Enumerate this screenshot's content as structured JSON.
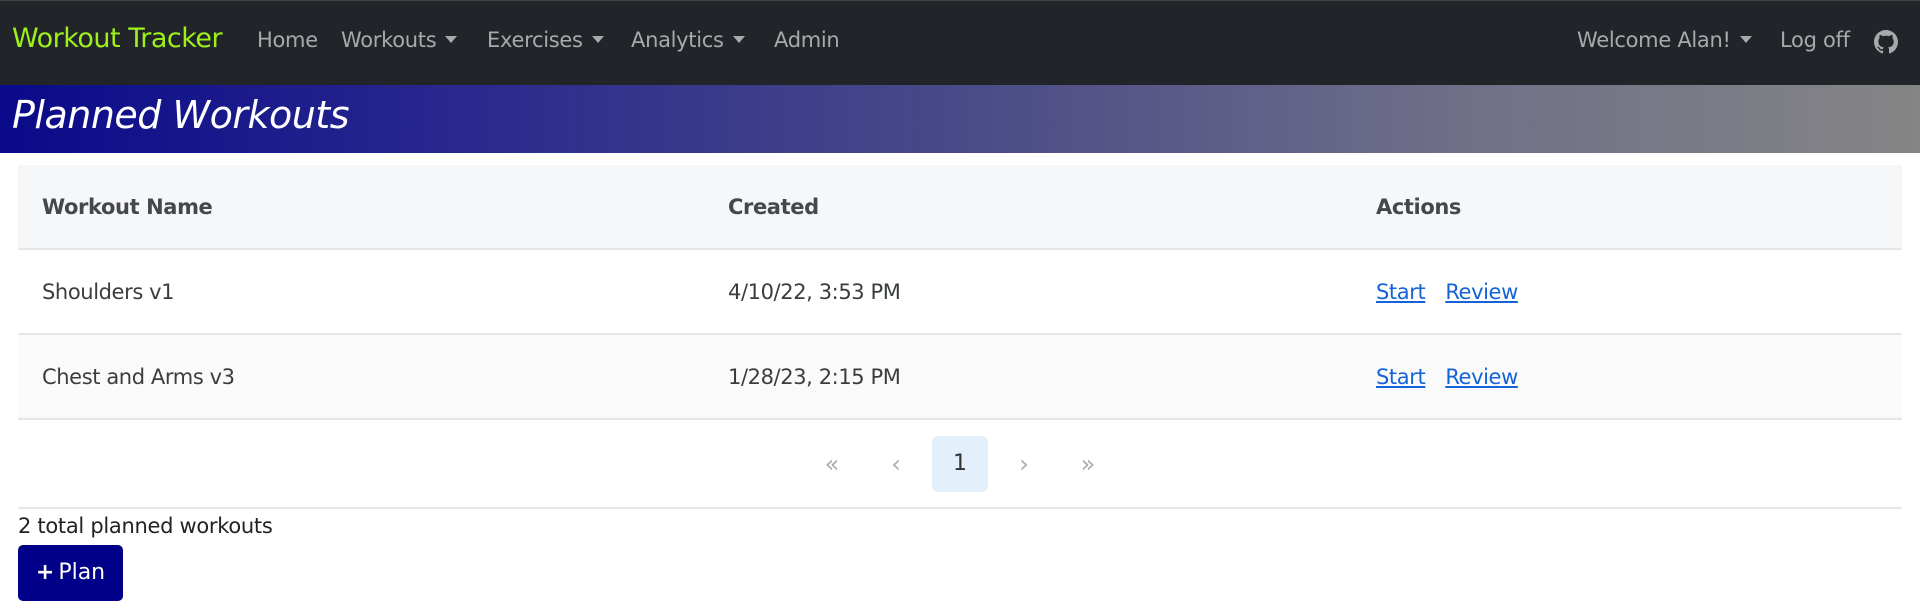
{
  "navbar": {
    "brand": "Workout Tracker",
    "links": [
      {
        "label": "Home",
        "dropdown": false
      },
      {
        "label": "Workouts",
        "dropdown": true
      },
      {
        "label": "Exercises",
        "dropdown": true
      },
      {
        "label": "Analytics",
        "dropdown": true
      },
      {
        "label": "Admin",
        "dropdown": false
      }
    ],
    "welcome": "Welcome Alan!",
    "logoff": "Log off",
    "github_icon": "github-icon",
    "colors": {
      "background": "#212529",
      "brand": "#9ef01a",
      "link": "#a7a9ac"
    }
  },
  "banner": {
    "title": "Planned Workouts"
  },
  "table": {
    "headers": [
      "Workout Name",
      "Created",
      "Actions"
    ],
    "rows": [
      {
        "name": "Shoulders v1",
        "created": "4/10/22, 3:53 PM",
        "actions": [
          "Start",
          "Review"
        ]
      },
      {
        "name": "Chest and Arms v3",
        "created": "1/28/23, 2:15 PM",
        "actions": [
          "Start",
          "Review"
        ]
      }
    ]
  },
  "pagination": {
    "first": "«",
    "prev": "‹",
    "current": "1",
    "next": "›",
    "last": "»"
  },
  "footer": {
    "total_text": "2 total planned workouts",
    "plan_button": "Plan",
    "plan_icon": "+"
  }
}
